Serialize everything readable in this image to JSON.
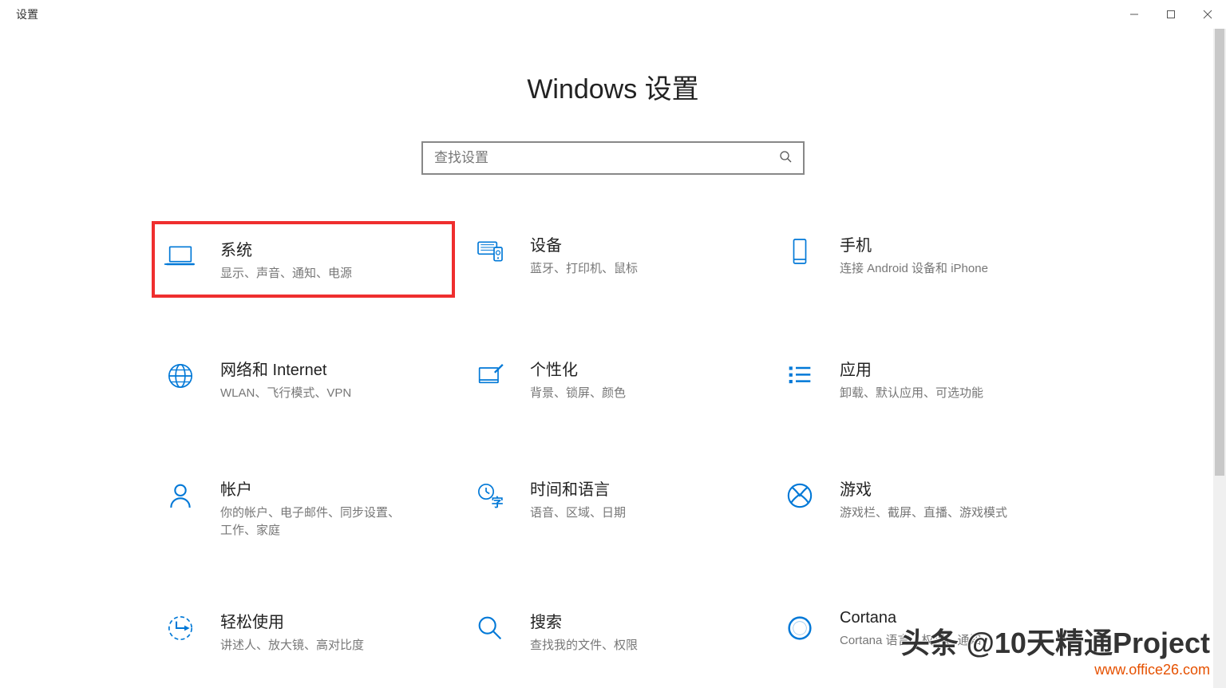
{
  "window": {
    "title": "设置"
  },
  "page_title": "Windows 设置",
  "search": {
    "placeholder": "查找设置"
  },
  "tiles": [
    {
      "title": "系统",
      "desc": "显示、声音、通知、电源"
    },
    {
      "title": "设备",
      "desc": "蓝牙、打印机、鼠标"
    },
    {
      "title": "手机",
      "desc": "连接 Android 设备和 iPhone"
    },
    {
      "title": "网络和 Internet",
      "desc": "WLAN、飞行模式、VPN"
    },
    {
      "title": "个性化",
      "desc": "背景、锁屏、颜色"
    },
    {
      "title": "应用",
      "desc": "卸载、默认应用、可选功能"
    },
    {
      "title": "帐户",
      "desc": "你的帐户、电子邮件、同步设置、工作、家庭"
    },
    {
      "title": "时间和语言",
      "desc": "语音、区域、日期"
    },
    {
      "title": "游戏",
      "desc": "游戏栏、截屏、直播、游戏模式"
    },
    {
      "title": "轻松使用",
      "desc": "讲述人、放大镜、高对比度"
    },
    {
      "title": "搜索",
      "desc": "查找我的文件、权限"
    },
    {
      "title": "Cortana",
      "desc": "Cortana 语言、权限、通知"
    }
  ],
  "watermark": {
    "main": "头条 @10天精通Project",
    "sub": "www.office26.com"
  }
}
